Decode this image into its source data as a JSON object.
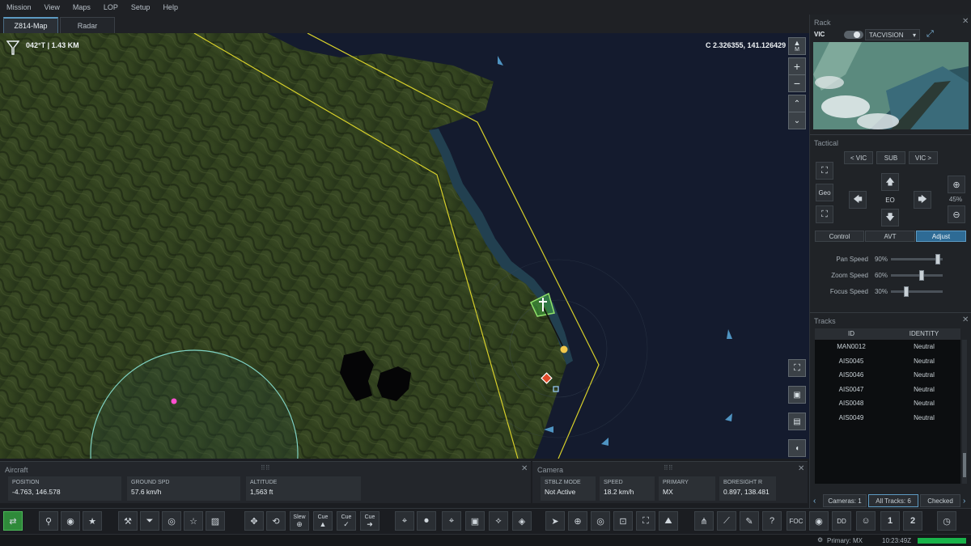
{
  "menu": [
    "Mission",
    "View",
    "Maps",
    "LOP",
    "Setup",
    "Help"
  ],
  "map_tabs": [
    {
      "label": "Z814-Map",
      "active": true
    },
    {
      "label": "Radar",
      "active": false
    }
  ],
  "map": {
    "heading_readout": "042°T | 1.43 KM",
    "coord_readout": "C 2.326355, 141.126429",
    "compass_label": "M",
    "zoom_in": "+",
    "zoom_out": "−"
  },
  "rack": {
    "title": "Rack",
    "vic_label": "VIC",
    "mode_select": "TACVISION"
  },
  "tactical": {
    "title": "Tactical",
    "prev_vic": "< VIC",
    "sub": "SUB",
    "next_vic": "VIC >",
    "geo": "Geo",
    "eo": "EO",
    "zoom_pct": "45%",
    "tabs": [
      {
        "label": "Control",
        "active": false
      },
      {
        "label": "AVT",
        "active": false
      },
      {
        "label": "Adjust",
        "active": true
      }
    ],
    "sliders": [
      {
        "label": "Pan Speed",
        "pct": "90%",
        "value": 0.9
      },
      {
        "label": "Zoom Speed",
        "pct": "60%",
        "value": 0.6
      },
      {
        "label": "Focus Speed",
        "pct": "30%",
        "value": 0.3
      }
    ]
  },
  "tracks": {
    "title": "Tracks",
    "col_id": "ID",
    "col_identity": "IDENTITY",
    "rows": [
      {
        "id": "MAN0012",
        "identity": "Neutral"
      },
      {
        "id": "AIS0045",
        "identity": "Neutral"
      },
      {
        "id": "AIS0046",
        "identity": "Neutral"
      },
      {
        "id": "AIS0047",
        "identity": "Neutral"
      },
      {
        "id": "AIS0048",
        "identity": "Neutral"
      },
      {
        "id": "AIS0049",
        "identity": "Neutral"
      }
    ],
    "footer_tabs": [
      {
        "label": "Cameras: 1"
      },
      {
        "label": "All Tracks: 6"
      },
      {
        "label": "Checked"
      }
    ]
  },
  "aircraft": {
    "title": "Aircraft",
    "fields": [
      {
        "k": "POSITION",
        "v": "-4.763, 146.578"
      },
      {
        "k": "GROUND SPD",
        "v": "57.6 km/h"
      },
      {
        "k": "ALTITUDE",
        "v": "1,563 ft"
      }
    ]
  },
  "camera": {
    "title": "Camera",
    "fields": [
      {
        "k": "STBLZ MODE",
        "v": "Not Active"
      },
      {
        "k": "SPEED",
        "v": "18.2 km/h"
      },
      {
        "k": "PRIMARY",
        "v": "MX"
      },
      {
        "k": "BORESIGHT R",
        "v": "0.897, 138.481"
      }
    ]
  },
  "toolbar": {
    "slew": "Slew",
    "cue": "Cue",
    "foc": "FOC",
    "dd": "DD",
    "one": "1",
    "two": "2"
  },
  "status": {
    "primary": "Primary: MX",
    "time": "10:23:49Z"
  },
  "colors": {
    "accent": "#5d9ac2",
    "active_tab": "#2e6b95",
    "zone": "#d6cf2a",
    "range_ring": "#7fd1c2",
    "status_bar": "#19b34a"
  }
}
